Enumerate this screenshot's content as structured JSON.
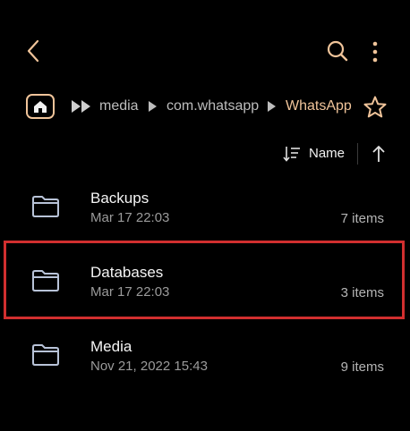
{
  "header": {
    "back_icon": "chevron-left-icon",
    "search_icon": "search-icon",
    "more_icon": "more-vertical-icon"
  },
  "breadcrumb": {
    "home_icon": "home-icon",
    "expand_icon": "double-arrow-icon",
    "items": [
      "media",
      "com.whatsapp",
      "WhatsApp"
    ],
    "star_icon": "star-outline-icon",
    "active_color": "#f0c49a"
  },
  "sort": {
    "label": "Name",
    "direction_icon": "arrow-up-icon"
  },
  "files": [
    {
      "name": "Backups",
      "date": "Mar 17 22:03",
      "count": "7 items"
    },
    {
      "name": "Databases",
      "date": "Mar 17 22:03",
      "count": "3 items"
    },
    {
      "name": "Media",
      "date": "Nov 21, 2022 15:43",
      "count": "9 items"
    }
  ],
  "colors": {
    "background": "#000000",
    "accent": "#f0c49a",
    "highlight": "#d12f2f"
  }
}
